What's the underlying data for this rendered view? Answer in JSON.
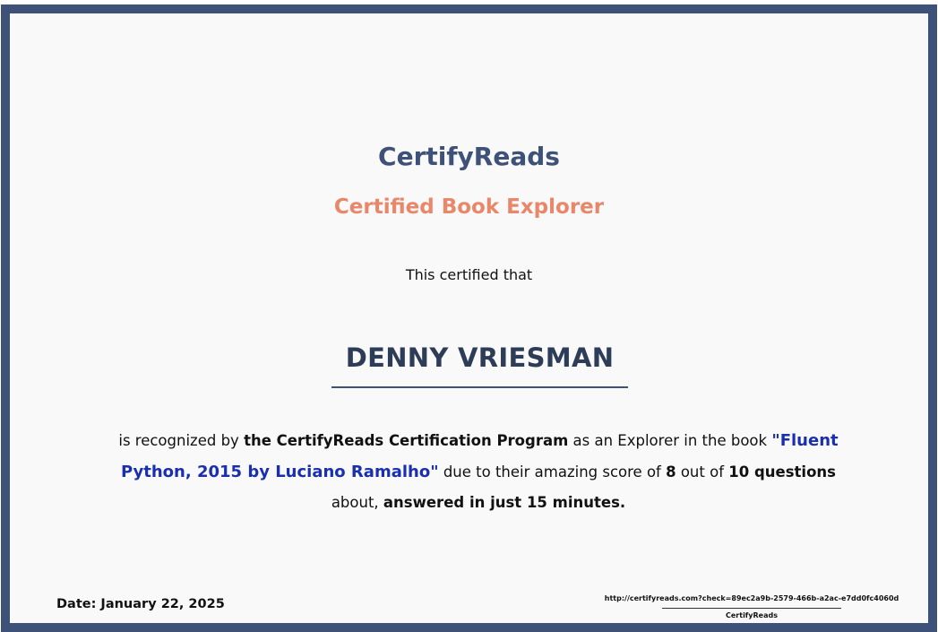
{
  "certificate": {
    "brand": "CertifyReads",
    "subtitle": "Certified Book Explorer",
    "intro": "This certified that",
    "recipient_name": "DENNY VRIESMAN",
    "body": {
      "part1": "is recognized by ",
      "program": "the CertifyReads Certification Program",
      "part2": " as an Explorer in the book ",
      "book": "\"Fluent Python, 2015 by Luciano Ramalho\"",
      "part3": " due to their amazing score of ",
      "score": "8",
      "part4": " out of ",
      "total": "10 questions",
      "part5": " about, ",
      "time": "answered in just 15 minutes."
    },
    "date": "Date: January 22, 2025",
    "verify_url": "http://certifyreads.com?check=89ec2a9b-2579-466b-a2ac-e7dd0fc4060d",
    "signature_label": "CertifyReads"
  },
  "colors": {
    "border": "#3e5178",
    "brand": "#3e5178",
    "subtitle": "#e8876a",
    "book_link": "#1a2fb0",
    "background": "#f9f9f9"
  }
}
